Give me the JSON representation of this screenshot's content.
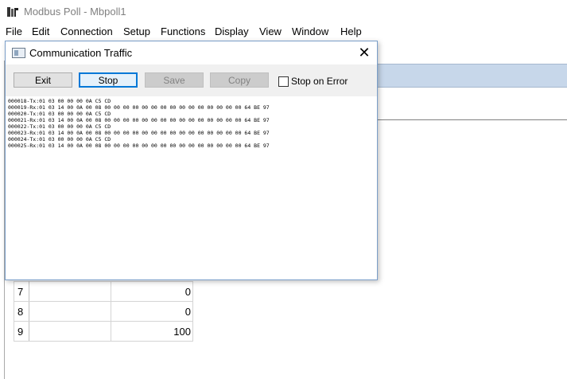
{
  "app": {
    "title": "Modbus Poll - Mbpoll1"
  },
  "menu": [
    "File",
    "Edit",
    "Connection",
    "Setup",
    "Functions",
    "Display",
    "View",
    "Window",
    "Help"
  ],
  "dialog": {
    "title": "Communication Traffic",
    "buttons": {
      "exit": "Exit",
      "stop": "Stop",
      "save": "Save",
      "copy": "Copy"
    },
    "stop_on_error": {
      "label": "Stop on Error",
      "checked": false
    },
    "traffic": [
      "000018-Tx:01 03 00 00 00 0A C5 CD",
      "000019-Rx:01 03 14 00 0A 00 08 00 00 00 00 00 00 00 00 00 00 00 00 00 00 00 64 BE 97",
      "000020-Tx:01 03 00 00 00 0A C5 CD",
      "000021-Rx:01 03 14 00 0A 00 08 00 00 00 00 00 00 00 00 00 00 00 00 00 00 00 64 BE 97",
      "000022-Tx:01 03 00 00 00 0A C5 CD",
      "000023-Rx:01 03 14 00 0A 00 08 00 00 00 00 00 00 00 00 00 00 00 00 00 00 00 64 BE 97",
      "000024-Tx:01 03 00 00 00 0A C5 CD",
      "000025-Rx:01 03 14 00 0A 00 08 00 00 00 00 00 00 00 00 00 00 00 00 00 00 00 64 BE 97"
    ]
  },
  "grid": {
    "rows": [
      {
        "index": "7",
        "alias": "",
        "value": "0"
      },
      {
        "index": "8",
        "alias": "",
        "value": "0"
      },
      {
        "index": "9",
        "alias": "",
        "value": "100"
      }
    ]
  }
}
